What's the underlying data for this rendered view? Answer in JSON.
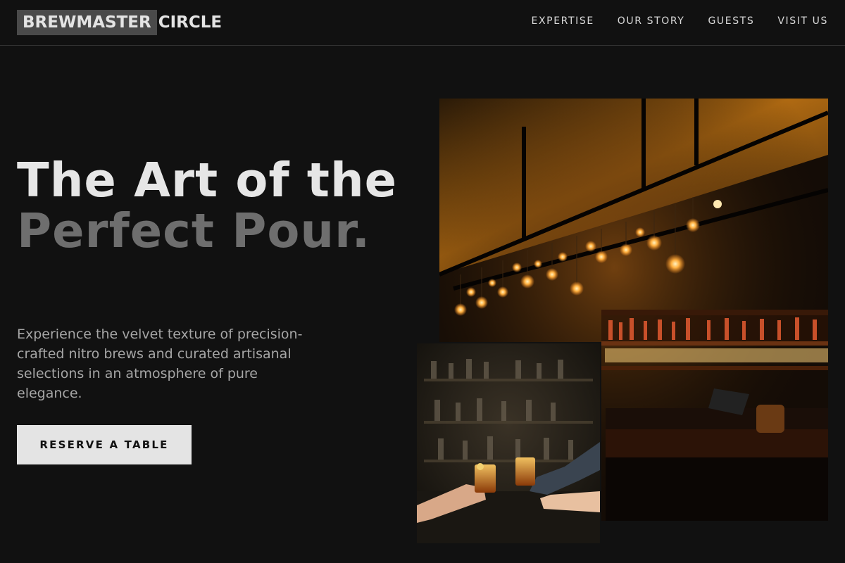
{
  "header": {
    "logo_highlight": "BREWMASTER",
    "logo_rest": "CIRCLE",
    "nav": [
      {
        "label": "EXPERTISE"
      },
      {
        "label": "OUR STORY"
      },
      {
        "label": "GUESTS"
      },
      {
        "label": "VISIT US"
      }
    ]
  },
  "hero": {
    "title_line1": "The Art of the",
    "title_line2": "Perfect Pour.",
    "description": "Experience the velvet texture of precision-crafted nitro brews and curated artisanal selections in an atmosphere of pure elegance.",
    "cta_label": "RESERVE A TABLE"
  },
  "images": {
    "main": "bar-interior-photo",
    "small": "toasting-drinks-photo"
  },
  "colors": {
    "background": "#111111",
    "text": "#e4e4e4",
    "muted_title": "#6e6e6e",
    "logo_highlight_bg": "#4a4a4a",
    "button_bg": "#e4e4e4",
    "accent_light": "#f0a030"
  }
}
